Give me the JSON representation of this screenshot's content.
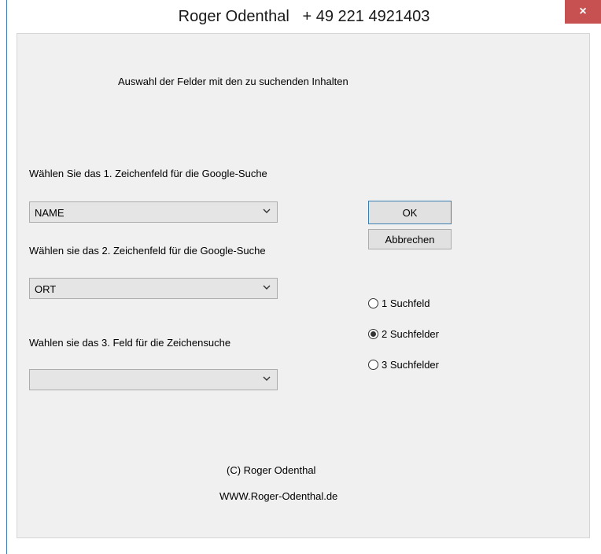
{
  "window": {
    "title": "Roger Odenthal   + 49 221 4921403",
    "close_glyph": "×"
  },
  "dialog": {
    "heading": "Auswahl der Felder mit den zu suchenden Inhalten",
    "field1_label": "Wählen Sie das 1. Zeichenfeld für die Google-Suche",
    "field1_value": "NAME",
    "field2_label": "Wählen sie das 2. Zeichenfeld für die Google-Suche",
    "field2_value": "ORT",
    "field3_label": "Wahlen sie das 3. Feld für die Zeichensuche",
    "field3_value": "",
    "ok_label": "OK",
    "cancel_label": "Abbrechen",
    "radio_options": [
      "1 Suchfeld",
      "2 Suchfelder",
      "3 Suchfelder"
    ],
    "radio_selected_index": 1,
    "copyright": "(C) Roger Odenthal",
    "website": "WWW.Roger-Odenthal.de"
  },
  "colors": {
    "close_button": "#c75050",
    "client_background": "#f0f0f0",
    "accent_border": "#3c7fb1"
  }
}
